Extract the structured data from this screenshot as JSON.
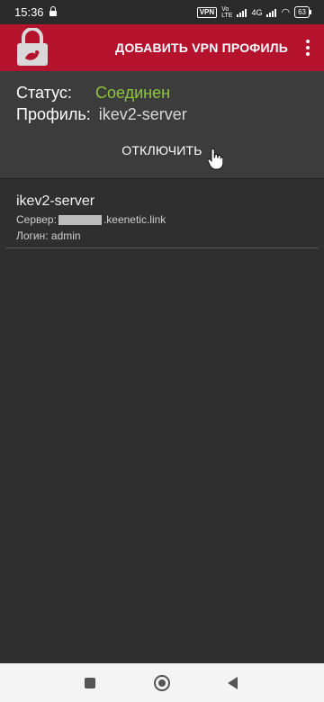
{
  "statusbar": {
    "time": "15:36",
    "vpn_badge": "VPN",
    "network": "4G",
    "battery": "63"
  },
  "appbar": {
    "add_profile_label": "ДОБАВИТЬ VPN ПРОФИЛЬ"
  },
  "status_panel": {
    "status_label": "Статус:",
    "status_value": "Соединен",
    "profile_label": "Профиль:",
    "profile_value": "ikev2-server",
    "disconnect_label": "ОТКЛЮЧИТЬ"
  },
  "profiles": [
    {
      "name": "ikev2-server",
      "server_label": "Сервер:",
      "server_suffix": ".keenetic.link",
      "login": "Логин: admin"
    }
  ],
  "colors": {
    "brand": "#b5122e",
    "connected": "#8dc63f",
    "background": "#2f2f2f"
  }
}
